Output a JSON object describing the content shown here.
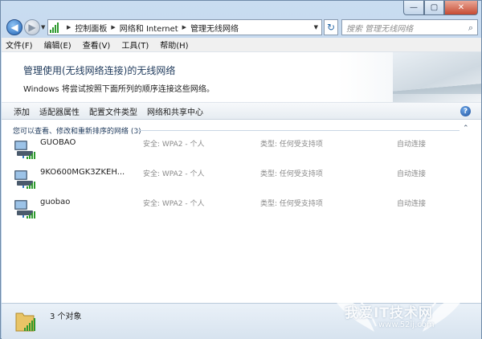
{
  "window": {
    "min_icon": "minimize-icon",
    "max_icon": "maximize-icon",
    "close_icon": "close-icon",
    "close_color": "#c64b33"
  },
  "address": {
    "back_icon": "back-arrow-icon",
    "forward_icon": "forward-arrow-icon",
    "crumbs": [
      "控制面板",
      "网络和 Internet",
      "管理无线网络"
    ],
    "refresh_icon": "refresh-icon",
    "search_placeholder": "搜索 管理无线网络"
  },
  "menu": {
    "items": [
      "文件(F)",
      "编辑(E)",
      "查看(V)",
      "工具(T)",
      "帮助(H)"
    ]
  },
  "header": {
    "title": "管理使用(无线网络连接)的无线网络",
    "description": "Windows 将尝试按照下面所列的顺序连接这些网络。"
  },
  "commands": {
    "items": [
      "添加",
      "适配器属性",
      "配置文件类型",
      "网络和共享中心"
    ],
    "help_icon": "help-icon"
  },
  "group": {
    "label": "您可以查看、修改和重新排序的网络 (3)"
  },
  "networks": [
    {
      "name": "GUOBAO",
      "security": "安全: WPA2 - 个人",
      "type": "类型: 任何受支持项",
      "mode": "自动连接"
    },
    {
      "name": "9KO600MGK3ZKEH...",
      "security": "安全: WPA2 - 个人",
      "type": "类型: 任何受支持项",
      "mode": "自动连接"
    },
    {
      "name": "guobao",
      "security": "安全: WPA2 - 个人",
      "type": "类型: 任何受支持项",
      "mode": "自动连接"
    }
  ],
  "status": {
    "text": "3 个对象",
    "icon": "wireless-folder-icon"
  },
  "watermark": {
    "cn": "我爱IT技术网",
    "url": "www.52ij.com"
  },
  "colors": {
    "title": "#1e395b",
    "accent": "#1f62b4"
  }
}
